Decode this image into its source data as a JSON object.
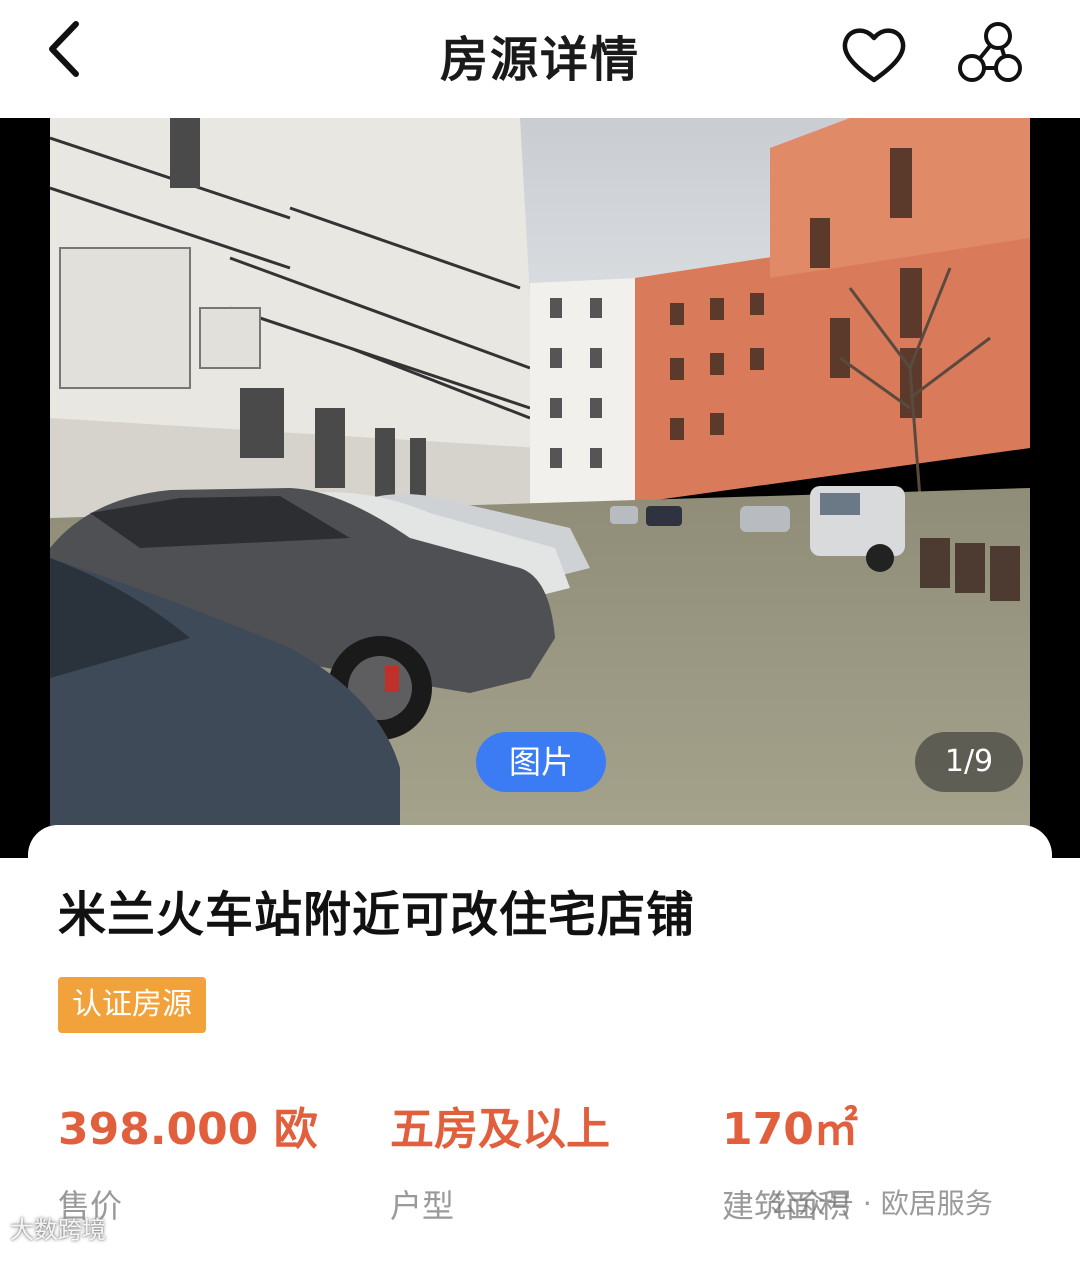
{
  "header": {
    "title": "房源详情"
  },
  "gallery": {
    "tag_label": "图片",
    "counter": "1/9"
  },
  "listing": {
    "title": "米兰火车站附近可改住宅店铺",
    "badge": "认证房源",
    "stats": [
      {
        "value": "398.000 欧",
        "label": "售价"
      },
      {
        "value": "五房及以上",
        "label": "户型"
      },
      {
        "value": "170㎡",
        "label": "建筑面积"
      }
    ]
  },
  "watermarks": {
    "left": "大数跨境",
    "right": "公众号 · 欧居服务"
  },
  "colors": {
    "accent_price": "#e25f3e",
    "badge_bg": "#f2a23a",
    "pill_bg": "#3b7cf4"
  }
}
